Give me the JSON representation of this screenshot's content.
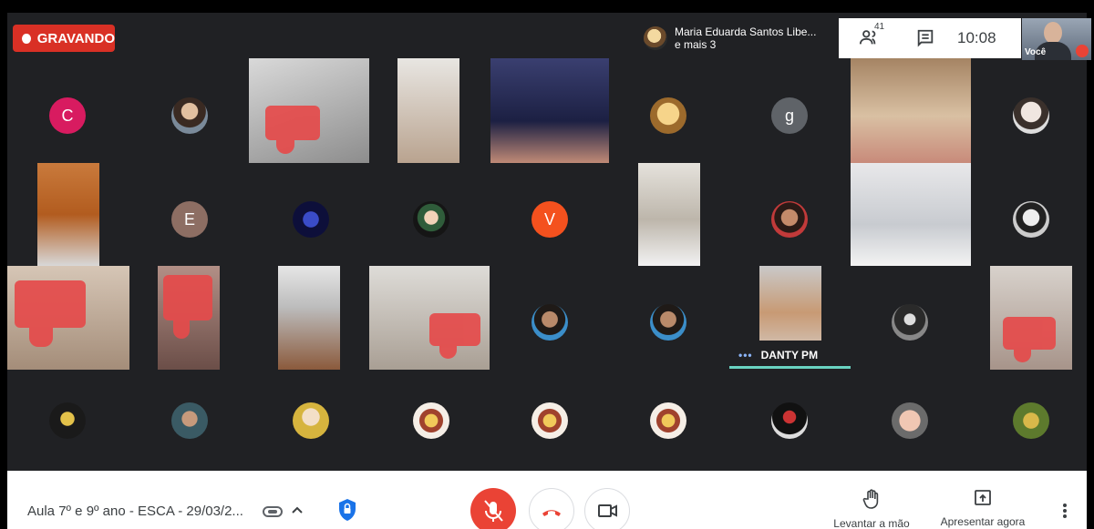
{
  "recording": {
    "label": "GRAVANDO"
  },
  "speaker": {
    "name": "Maria Eduarda Santos Libe...",
    "others": "e mais 3"
  },
  "header": {
    "participants_count": "41",
    "time": "10:08",
    "self_label": "Você"
  },
  "tiles": {
    "letters": {
      "c": "C",
      "g": "g",
      "e": "E",
      "v": "V"
    },
    "active_speaker_name": "DANTY PM"
  },
  "bottom": {
    "meeting_title": "Aula 7º e 9º ano - ESCA - 29/03/2...",
    "raise_hand": "Levantar a mão",
    "present_now": "Apresentar agora"
  },
  "colors": {
    "recording": "#d93025",
    "letter_c": "#d81b60",
    "letter_g": "#5f6368",
    "letter_e": "#8d6e63",
    "letter_v": "#f4511e",
    "end_call": "#ea4335",
    "active_bar": "#69d3c1"
  },
  "icons": [
    "people-icon",
    "chat-icon",
    "mic-off-icon",
    "end-call-icon",
    "camera-icon",
    "raise-hand-icon",
    "present-icon",
    "more-icon",
    "attachment-icon",
    "chevron-up-icon",
    "security-icon",
    "thumbs-down-reaction"
  ]
}
